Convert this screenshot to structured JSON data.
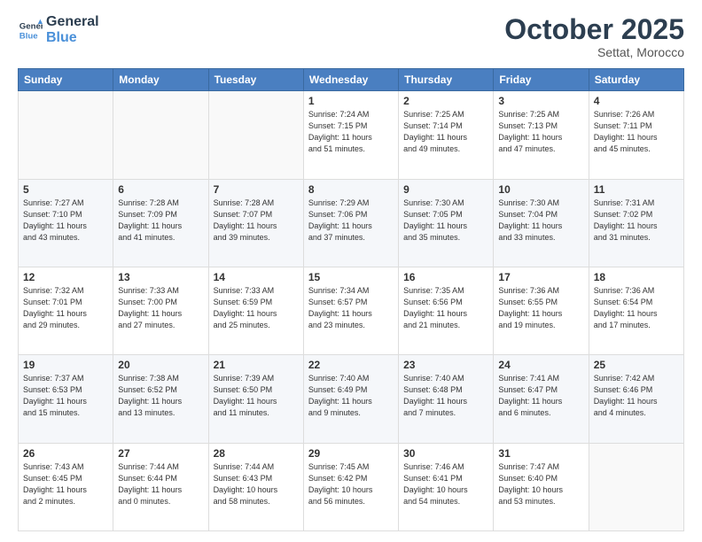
{
  "header": {
    "logo_line1": "General",
    "logo_line2": "Blue",
    "month": "October 2025",
    "location": "Settat, Morocco"
  },
  "days_of_week": [
    "Sunday",
    "Monday",
    "Tuesday",
    "Wednesday",
    "Thursday",
    "Friday",
    "Saturday"
  ],
  "weeks": [
    [
      {
        "day": "",
        "lines": []
      },
      {
        "day": "",
        "lines": []
      },
      {
        "day": "",
        "lines": []
      },
      {
        "day": "1",
        "lines": [
          "Sunrise: 7:24 AM",
          "Sunset: 7:15 PM",
          "Daylight: 11 hours",
          "and 51 minutes."
        ]
      },
      {
        "day": "2",
        "lines": [
          "Sunrise: 7:25 AM",
          "Sunset: 7:14 PM",
          "Daylight: 11 hours",
          "and 49 minutes."
        ]
      },
      {
        "day": "3",
        "lines": [
          "Sunrise: 7:25 AM",
          "Sunset: 7:13 PM",
          "Daylight: 11 hours",
          "and 47 minutes."
        ]
      },
      {
        "day": "4",
        "lines": [
          "Sunrise: 7:26 AM",
          "Sunset: 7:11 PM",
          "Daylight: 11 hours",
          "and 45 minutes."
        ]
      }
    ],
    [
      {
        "day": "5",
        "lines": [
          "Sunrise: 7:27 AM",
          "Sunset: 7:10 PM",
          "Daylight: 11 hours",
          "and 43 minutes."
        ]
      },
      {
        "day": "6",
        "lines": [
          "Sunrise: 7:28 AM",
          "Sunset: 7:09 PM",
          "Daylight: 11 hours",
          "and 41 minutes."
        ]
      },
      {
        "day": "7",
        "lines": [
          "Sunrise: 7:28 AM",
          "Sunset: 7:07 PM",
          "Daylight: 11 hours",
          "and 39 minutes."
        ]
      },
      {
        "day": "8",
        "lines": [
          "Sunrise: 7:29 AM",
          "Sunset: 7:06 PM",
          "Daylight: 11 hours",
          "and 37 minutes."
        ]
      },
      {
        "day": "9",
        "lines": [
          "Sunrise: 7:30 AM",
          "Sunset: 7:05 PM",
          "Daylight: 11 hours",
          "and 35 minutes."
        ]
      },
      {
        "day": "10",
        "lines": [
          "Sunrise: 7:30 AM",
          "Sunset: 7:04 PM",
          "Daylight: 11 hours",
          "and 33 minutes."
        ]
      },
      {
        "day": "11",
        "lines": [
          "Sunrise: 7:31 AM",
          "Sunset: 7:02 PM",
          "Daylight: 11 hours",
          "and 31 minutes."
        ]
      }
    ],
    [
      {
        "day": "12",
        "lines": [
          "Sunrise: 7:32 AM",
          "Sunset: 7:01 PM",
          "Daylight: 11 hours",
          "and 29 minutes."
        ]
      },
      {
        "day": "13",
        "lines": [
          "Sunrise: 7:33 AM",
          "Sunset: 7:00 PM",
          "Daylight: 11 hours",
          "and 27 minutes."
        ]
      },
      {
        "day": "14",
        "lines": [
          "Sunrise: 7:33 AM",
          "Sunset: 6:59 PM",
          "Daylight: 11 hours",
          "and 25 minutes."
        ]
      },
      {
        "day": "15",
        "lines": [
          "Sunrise: 7:34 AM",
          "Sunset: 6:57 PM",
          "Daylight: 11 hours",
          "and 23 minutes."
        ]
      },
      {
        "day": "16",
        "lines": [
          "Sunrise: 7:35 AM",
          "Sunset: 6:56 PM",
          "Daylight: 11 hours",
          "and 21 minutes."
        ]
      },
      {
        "day": "17",
        "lines": [
          "Sunrise: 7:36 AM",
          "Sunset: 6:55 PM",
          "Daylight: 11 hours",
          "and 19 minutes."
        ]
      },
      {
        "day": "18",
        "lines": [
          "Sunrise: 7:36 AM",
          "Sunset: 6:54 PM",
          "Daylight: 11 hours",
          "and 17 minutes."
        ]
      }
    ],
    [
      {
        "day": "19",
        "lines": [
          "Sunrise: 7:37 AM",
          "Sunset: 6:53 PM",
          "Daylight: 11 hours",
          "and 15 minutes."
        ]
      },
      {
        "day": "20",
        "lines": [
          "Sunrise: 7:38 AM",
          "Sunset: 6:52 PM",
          "Daylight: 11 hours",
          "and 13 minutes."
        ]
      },
      {
        "day": "21",
        "lines": [
          "Sunrise: 7:39 AM",
          "Sunset: 6:50 PM",
          "Daylight: 11 hours",
          "and 11 minutes."
        ]
      },
      {
        "day": "22",
        "lines": [
          "Sunrise: 7:40 AM",
          "Sunset: 6:49 PM",
          "Daylight: 11 hours",
          "and 9 minutes."
        ]
      },
      {
        "day": "23",
        "lines": [
          "Sunrise: 7:40 AM",
          "Sunset: 6:48 PM",
          "Daylight: 11 hours",
          "and 7 minutes."
        ]
      },
      {
        "day": "24",
        "lines": [
          "Sunrise: 7:41 AM",
          "Sunset: 6:47 PM",
          "Daylight: 11 hours",
          "and 6 minutes."
        ]
      },
      {
        "day": "25",
        "lines": [
          "Sunrise: 7:42 AM",
          "Sunset: 6:46 PM",
          "Daylight: 11 hours",
          "and 4 minutes."
        ]
      }
    ],
    [
      {
        "day": "26",
        "lines": [
          "Sunrise: 7:43 AM",
          "Sunset: 6:45 PM",
          "Daylight: 11 hours",
          "and 2 minutes."
        ]
      },
      {
        "day": "27",
        "lines": [
          "Sunrise: 7:44 AM",
          "Sunset: 6:44 PM",
          "Daylight: 11 hours",
          "and 0 minutes."
        ]
      },
      {
        "day": "28",
        "lines": [
          "Sunrise: 7:44 AM",
          "Sunset: 6:43 PM",
          "Daylight: 10 hours",
          "and 58 minutes."
        ]
      },
      {
        "day": "29",
        "lines": [
          "Sunrise: 7:45 AM",
          "Sunset: 6:42 PM",
          "Daylight: 10 hours",
          "and 56 minutes."
        ]
      },
      {
        "day": "30",
        "lines": [
          "Sunrise: 7:46 AM",
          "Sunset: 6:41 PM",
          "Daylight: 10 hours",
          "and 54 minutes."
        ]
      },
      {
        "day": "31",
        "lines": [
          "Sunrise: 7:47 AM",
          "Sunset: 6:40 PM",
          "Daylight: 10 hours",
          "and 53 minutes."
        ]
      },
      {
        "day": "",
        "lines": []
      }
    ]
  ]
}
